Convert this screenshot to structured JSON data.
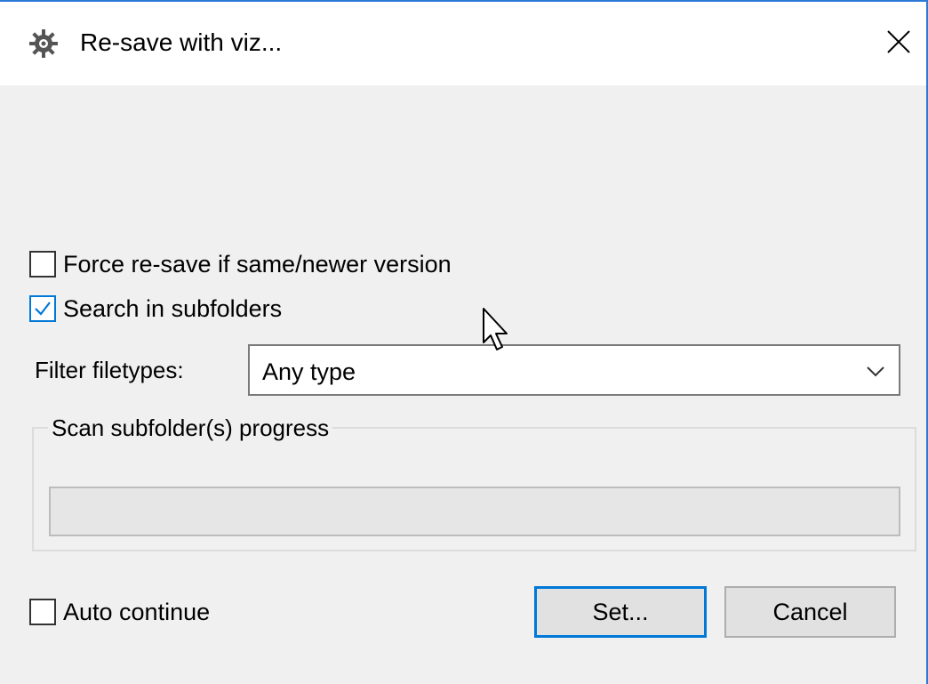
{
  "window": {
    "title": "Re-save with viz...",
    "title_icon": "gear-icon",
    "close_icon": "close-icon"
  },
  "options": {
    "force_resave": {
      "label": "Force re-save if same/newer version",
      "checked": false
    },
    "search_subfolders": {
      "label": "Search in subfolders",
      "checked": true
    },
    "auto_continue": {
      "label": "Auto continue",
      "checked": false
    }
  },
  "filter": {
    "label": "Filter filetypes:",
    "selected": "Any type",
    "dropdown_icon": "chevron-down-icon"
  },
  "scan": {
    "group_title": "Scan subfolder(s) progress",
    "progress": 0
  },
  "buttons": {
    "set_label": "Set...",
    "cancel_label": "Cancel"
  },
  "colors": {
    "accent": "#0078d7",
    "window_border": "#2b79d8",
    "background": "#f0f0f0"
  }
}
